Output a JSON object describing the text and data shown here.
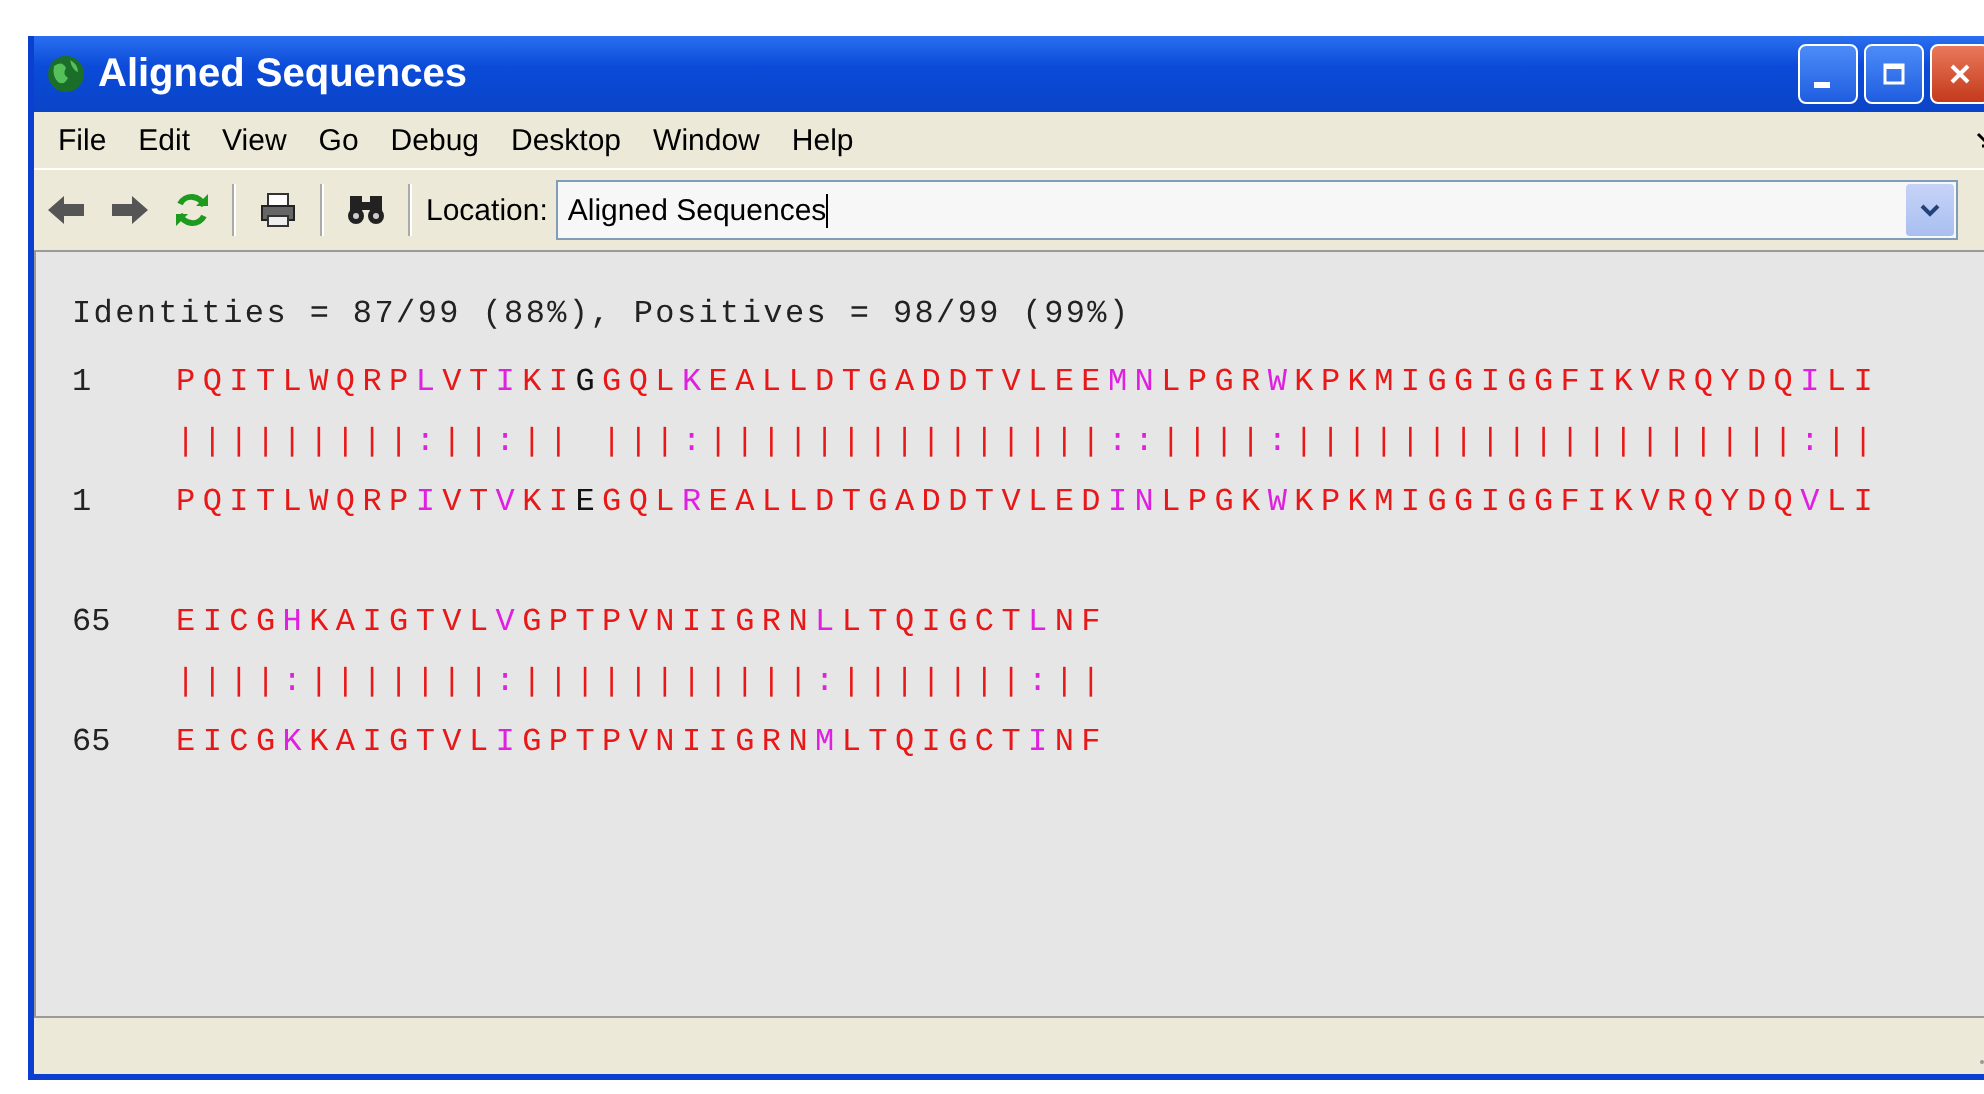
{
  "window": {
    "title": "Aligned Sequences"
  },
  "menu": [
    "File",
    "Edit",
    "View",
    "Go",
    "Debug",
    "Desktop",
    "Window",
    "Help"
  ],
  "location": {
    "label": "Location:",
    "value": "Aligned Sequences"
  },
  "summary": "Identities = 87/99 (88%), Positives = 98/99 (99%)",
  "blocks": [
    {
      "query_start": "1",
      "query": "PQITLWQRPLVTIKIGGQLKEALLDTGADDTVLEEMNLPGRWKPKMIGGIGGFIKVRQYDQILI",
      "match": "|||||||||:||:|| |||:|||||||||||||||::||||:|||||||||||||||||||:||",
      "subject_start": "1",
      "subject": "PQITLWQRPIVTVKIEGQLREALLDTGADDTVLEDINLPGKWKPKMIGGIGGFIKVRQYDQVLI"
    },
    {
      "query_start": "65",
      "query": "EICGHKAIGTVLVGPTPVNIIGRNLLTQIGCTLNF",
      "match": "||||:|||||||:|||||||||||:|||||||:||",
      "subject_start": "65",
      "subject": "EICGKKAIGTVLIGPTPVNIIGRNMLTQIGCTINF"
    }
  ]
}
